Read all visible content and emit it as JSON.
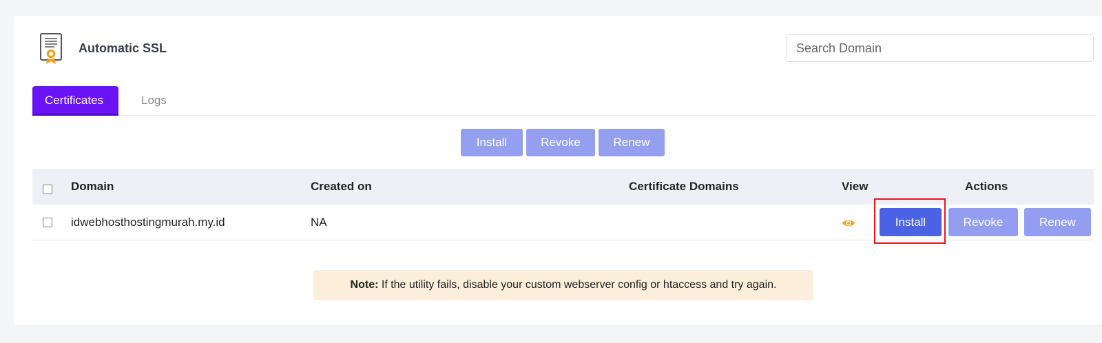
{
  "header": {
    "title": "Automatic SSL",
    "icon": "certificate-icon"
  },
  "search": {
    "placeholder": "Search Domain",
    "value": ""
  },
  "tabs": [
    {
      "label": "Certificates",
      "active": true
    },
    {
      "label": "Logs",
      "active": false
    }
  ],
  "bulk_actions": {
    "install": "Install",
    "revoke": "Revoke",
    "renew": "Renew"
  },
  "table": {
    "columns": [
      "Domain",
      "Created on",
      "Certificate Domains",
      "View",
      "Actions"
    ],
    "rows": [
      {
        "domain": "idwebhosthostingmurah.my.id",
        "created_on": "NA",
        "certificate_domains": "",
        "view_icon": "eye-icon",
        "actions": {
          "install": "Install",
          "revoke": "Revoke",
          "renew": "Renew"
        }
      }
    ]
  },
  "note": {
    "label": "Note:",
    "text": " If the utility fails, disable your custom webserver config or htaccess and try again."
  },
  "colors": {
    "tab_active": "#6a14f5",
    "button_primary": "#4a62e3",
    "button_muted": "#939ef0",
    "note_bg": "#fbeedb",
    "eye": "#f0a020",
    "highlight": "#e8131d"
  }
}
